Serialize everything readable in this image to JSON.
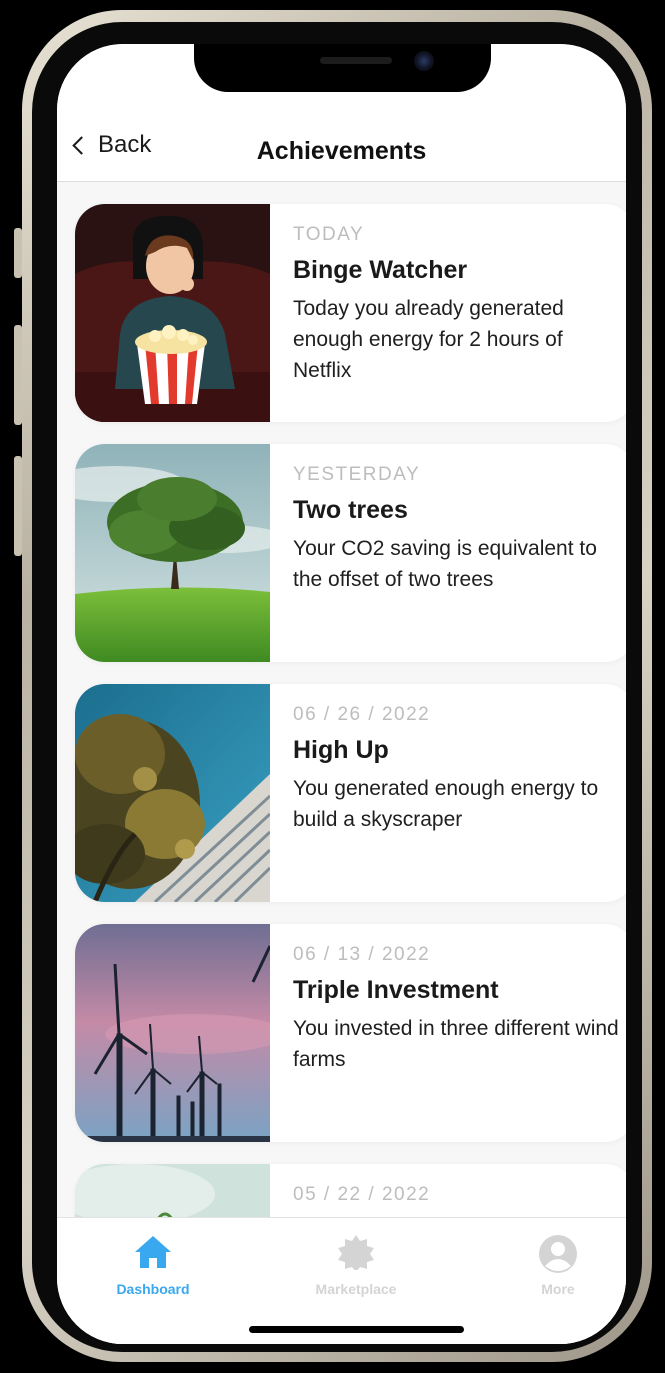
{
  "header": {
    "back_label": "Back",
    "title": "Achievements"
  },
  "achievements": [
    {
      "date": "TODAY",
      "title": "Binge Watcher",
      "description": "Today you already generated enough energy for 2 hours of Netflix"
    },
    {
      "date": "YESTERDAY",
      "title": "Two trees",
      "description": "Your CO2 saving is equivalent to the offset of two trees"
    },
    {
      "date": "06 / 26 / 2022",
      "title": "High Up",
      "description": "You generated enough energy to build a skyscraper"
    },
    {
      "date": "06 / 13 / 2022",
      "title": "Triple Investment",
      "description": "You invested in three different wind farms"
    },
    {
      "date": "05 / 22 / 2022",
      "title": "",
      "description": ""
    }
  ],
  "tabs": [
    {
      "label": "Dashboard",
      "icon": "home-icon",
      "active": true
    },
    {
      "label": "Marketplace",
      "icon": "badge-icon",
      "active": false
    },
    {
      "label": "More",
      "icon": "user-circle-icon",
      "active": false
    }
  ],
  "colors": {
    "accent": "#3aa8ee",
    "inactive": "#d4d4d4",
    "date": "#bdbdbd"
  }
}
